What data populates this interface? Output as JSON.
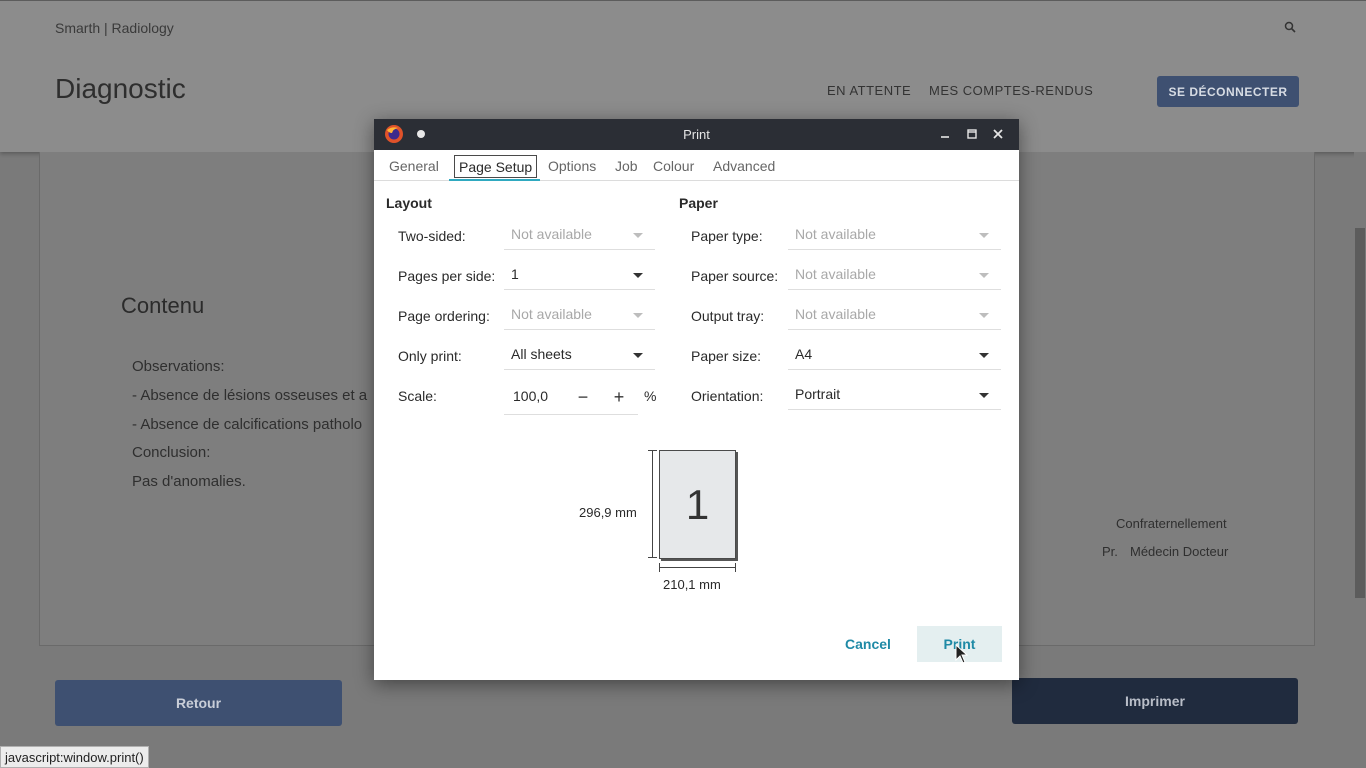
{
  "background": {
    "brand": "Smarth | Radiology",
    "page_title": "Diagnostic",
    "nav": {
      "waiting": "EN ATTENTE",
      "my_reports": "MES COMPTES-RENDUS",
      "logout": "SE DÉCONNECTER"
    },
    "content_title": "Contenu",
    "observations": [
      "Observations:",
      "- Absence de lésions osseuses et a",
      "- Absence de calcifications patholo",
      "Conclusion:",
      "Pas d'anomalies."
    ],
    "signature": {
      "closing": "Confraternellement",
      "prefix": "Pr.",
      "name": "Médecin Docteur"
    },
    "back_button": "Retour",
    "print_button": "Imprimer",
    "status_bar": "javascript:window.print()"
  },
  "dialog": {
    "title": "Print",
    "tabs": [
      "General",
      "Page Setup",
      "Options",
      "Job",
      "Colour",
      "Advanced"
    ],
    "active_tab": "Page Setup",
    "layout": {
      "title": "Layout",
      "two_sided": {
        "label": "Two-sided:",
        "value": "Not available"
      },
      "pages_per_side": {
        "label": "Pages per side:",
        "value": "1"
      },
      "page_ordering": {
        "label": "Page ordering:",
        "value": "Not available"
      },
      "only_print": {
        "label": "Only print:",
        "value": "All sheets"
      },
      "scale": {
        "label": "Scale:",
        "value": "100,0",
        "unit": "%"
      }
    },
    "paper": {
      "title": "Paper",
      "paper_type": {
        "label": "Paper type:",
        "value": "Not available"
      },
      "paper_source": {
        "label": "Paper source:",
        "value": "Not available"
      },
      "output_tray": {
        "label": "Output tray:",
        "value": "Not available"
      },
      "paper_size": {
        "label": "Paper size:",
        "value": "A4"
      },
      "orientation": {
        "label": "Orientation:",
        "value": "Portrait"
      }
    },
    "preview": {
      "page_number": "1",
      "width_label": "210,1 mm",
      "height_label": "296,9 mm"
    },
    "cancel_button": "Cancel",
    "print_button": "Print"
  },
  "colors": {
    "accent": "#1f8aa6",
    "tab_underline": "#2fa9c0",
    "titlebar": "#2b2e35",
    "primary_button": "#3e5071"
  }
}
